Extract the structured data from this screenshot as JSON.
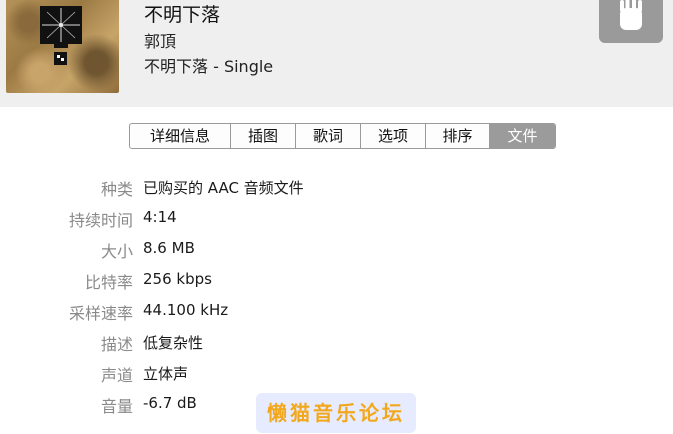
{
  "header": {
    "song_title": "不明下落",
    "artist": "郭頂",
    "album": "不明下落 - Single"
  },
  "tabs": [
    {
      "label": "详细信息",
      "active": false
    },
    {
      "label": "插图",
      "active": false
    },
    {
      "label": "歌词",
      "active": false
    },
    {
      "label": "选项",
      "active": false
    },
    {
      "label": "排序",
      "active": false
    },
    {
      "label": "文件",
      "active": true
    }
  ],
  "properties": [
    {
      "label": "种类",
      "value": "已购买的 AAC 音频文件"
    },
    {
      "label": "持续时间",
      "value": "4:14"
    },
    {
      "label": "大小",
      "value": "8.6 MB"
    },
    {
      "label": "比特率",
      "value": "256 kbps"
    },
    {
      "label": "采样速率",
      "value": "44.100 kHz"
    },
    {
      "label": "描述",
      "value": "低复杂性"
    },
    {
      "label": "声道",
      "value": "立体声"
    },
    {
      "label": "音量",
      "value": "-6.7 dB"
    }
  ],
  "watermark": "懒猫音乐论坛",
  "colors": {
    "header_bg": "#efefef",
    "active_tab_bg": "#9b9b9b",
    "label_gray": "#8a8a8a",
    "watermark_text": "#f2a81c",
    "watermark_bg": "#e7ebff"
  },
  "icons": {
    "artwork": "album-artwork",
    "device": "device-icon"
  }
}
